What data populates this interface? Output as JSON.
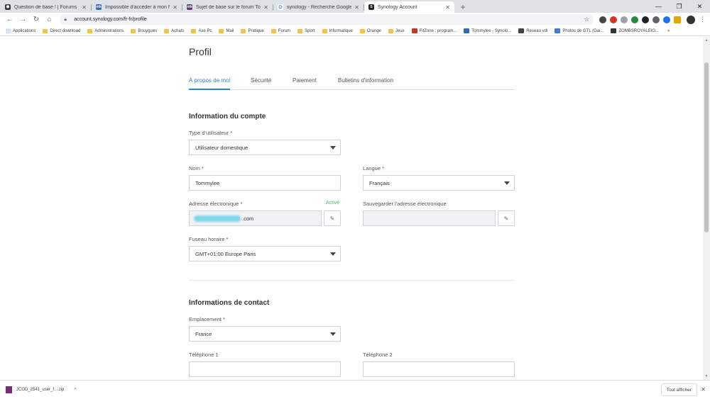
{
  "browser": {
    "tabs": [
      {
        "title": "Question de base ! | Forums",
        "favicon_color": "#3c3c3c",
        "favicon_glyph": "⬢"
      },
      {
        "title": "Impossible d'accéder à mon Na:",
        "favicon_color": "#2d6db5",
        "favicon_glyph": "ntk"
      },
      {
        "title": "Sujet de base sur le forum Tom ",
        "favicon_color": "#5a3d7a",
        "favicon_glyph": "ntk"
      },
      {
        "title": "synology - Recherche Google",
        "favicon_color": "#ffffff",
        "favicon_glyph": "G"
      },
      {
        "title": "Synology Account",
        "favicon_color": "#222222",
        "favicon_glyph": "S"
      }
    ],
    "new_tab_label": "+",
    "url": "account.synology.com/fr-fr/profile",
    "bookmarks": [
      {
        "label": "Applications",
        "kind": "apps"
      },
      {
        "label": "Direct download",
        "kind": "folder"
      },
      {
        "label": "Administrations",
        "kind": "folder"
      },
      {
        "label": "Bouygues",
        "kind": "folder"
      },
      {
        "label": "Achats",
        "kind": "folder"
      },
      {
        "label": "Axe Pc",
        "kind": "folder"
      },
      {
        "label": "Mail",
        "kind": "folder"
      },
      {
        "label": "Pratique",
        "kind": "folder"
      },
      {
        "label": "Forum",
        "kind": "folder"
      },
      {
        "label": "Sport",
        "kind": "folder"
      },
      {
        "label": "Informatique",
        "kind": "folder"
      },
      {
        "label": "Orange",
        "kind": "folder"
      },
      {
        "label": "Jeux",
        "kind": "folder"
      },
      {
        "label": "FitZone : program...",
        "kind": "site",
        "color": "#c0392b"
      },
      {
        "label": "Tommylee - Synolo...",
        "kind": "site",
        "color": "#2d6db5"
      },
      {
        "label": "Reseau vdi",
        "kind": "site",
        "color": "#444444"
      },
      {
        "label": "Photos de GTL (Gai...",
        "kind": "site",
        "color": "#3b7dd8"
      },
      {
        "label": "ZOMBSROYALEIO...",
        "kind": "site",
        "color": "#333333"
      }
    ],
    "more_bookmarks": "»"
  },
  "page": {
    "title": "Profil",
    "tabs": [
      "À propos de moi",
      "Sécurité",
      "Paiement",
      "Bulletins d'information"
    ],
    "active_tab": 0,
    "account_section": {
      "title": "Information du compte",
      "user_type_label": "Type d'utilisateur *",
      "user_type_value": "Utilisateur domestique",
      "name_label": "Nom *",
      "name_value": "Tommylee",
      "language_label": "Langue *",
      "language_value": "Français",
      "email_label": "Adresse électronique *",
      "email_status": "Activé",
      "email_value_suffix": ".com",
      "backup_email_label": "Sauvegarder l'adresse électronique",
      "backup_email_value": "",
      "timezone_label": "Fuseau horaire *",
      "timezone_value": "GMT+01:00 Europe Paris"
    },
    "contact_section": {
      "title": "Informations de contact",
      "location_label": "Emplacement *",
      "location_value": "France",
      "phone1_label": "Téléphone 1",
      "phone1_value": "",
      "phone2_label": "Téléphone 2",
      "phone2_value": ""
    }
  },
  "downloads": {
    "file": "JCOD_2541_user_f....zip",
    "show_all": "Tout afficher"
  },
  "colors": {
    "accent": "#2d7fd0",
    "active_status": "#5ab65a"
  }
}
